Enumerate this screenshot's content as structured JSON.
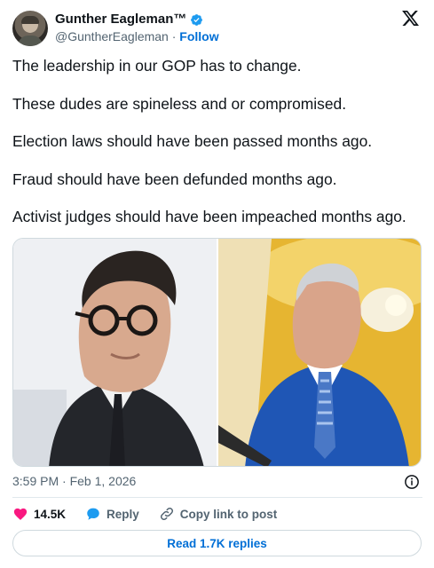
{
  "author": {
    "display_name": "Gunther Eagleman™",
    "handle": "@GuntherEagleman",
    "separator": "·",
    "follow_label": "Follow",
    "verified_color": "#1d9bf0"
  },
  "platform_icon": "x-logo-icon",
  "tweet": {
    "lines": [
      "The leadership in our GOP has to change.",
      "These dudes are spineless and or compromised.",
      "Election laws should have been passed months ago.",
      "Fraud should have been defunded months ago.",
      "Activist judges should have been impeached months ago."
    ]
  },
  "media": {
    "photos": [
      "photo-portrait-glasses",
      "photo-speaker-blue-suit"
    ]
  },
  "meta": {
    "timestamp": "3:59 PM · Feb 1, 2026"
  },
  "actions": {
    "like_count": "14.5K",
    "reply_label": "Reply",
    "copy_link_label": "Copy link to post"
  },
  "footer": {
    "read_replies_label": "Read 1.7K replies"
  },
  "colors": {
    "link_blue": "#006fd6",
    "heart_red": "#f91880",
    "reply_blue": "#1d9bf0",
    "muted": "#536471"
  }
}
